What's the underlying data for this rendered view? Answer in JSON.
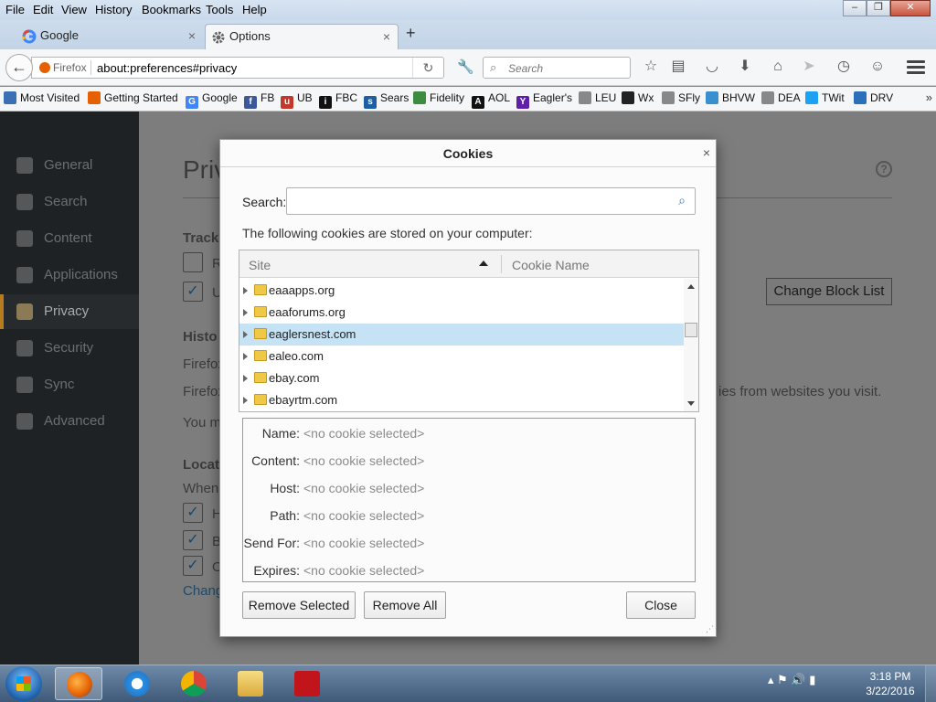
{
  "menubar": {
    "items": [
      "File",
      "Edit",
      "View",
      "History",
      "Bookmarks",
      "Tools",
      "Help"
    ],
    "accel": [
      "F",
      "E",
      "V",
      "s",
      "B",
      "T",
      "H"
    ]
  },
  "window_controls": {
    "minimize": "–",
    "maximize": "❐",
    "close": "✕"
  },
  "tabs": [
    {
      "label": "Google",
      "close": "×"
    },
    {
      "label": "Options",
      "close": "×"
    }
  ],
  "new_tab": "+",
  "navbar": {
    "identity": "Firefox",
    "url": "about:preferences#privacy",
    "search_placeholder": "Search"
  },
  "bookmarks": {
    "items": [
      {
        "label": "Most Visited",
        "color": "#3d6fb4",
        "glyph": ""
      },
      {
        "label": "Getting Started",
        "color": "#e66000",
        "glyph": ""
      },
      {
        "label": "Google",
        "color": "#4285f4",
        "glyph": "G"
      },
      {
        "label": "FB",
        "color": "#3b5998",
        "glyph": "f"
      },
      {
        "label": "UB",
        "color": "#c0392b",
        "glyph": "u"
      },
      {
        "label": "FBC",
        "color": "#111111",
        "glyph": "i"
      },
      {
        "label": "Sears",
        "color": "#1c5fa5",
        "glyph": "s"
      },
      {
        "label": "Fidelity",
        "color": "#3d8c40",
        "glyph": ""
      },
      {
        "label": "AOL",
        "color": "#111111",
        "glyph": "A"
      },
      {
        "label": "Eagler's",
        "color": "#5f1fa8",
        "glyph": "Y"
      },
      {
        "label": "LEU",
        "color": "#888888",
        "glyph": ""
      },
      {
        "label": "Wx",
        "color": "#222222",
        "glyph": ""
      },
      {
        "label": "SFly",
        "color": "#888888",
        "glyph": ""
      },
      {
        "label": "BHVW",
        "color": "#3a8fcf",
        "glyph": ""
      },
      {
        "label": "DEA",
        "color": "#888888",
        "glyph": ""
      },
      {
        "label": "TWit",
        "color": "#1da1f2",
        "glyph": ""
      },
      {
        "label": "DRV",
        "color": "#2c6fbb",
        "glyph": ""
      }
    ],
    "more": "»"
  },
  "sidebar": {
    "items": [
      {
        "label": "General"
      },
      {
        "label": "Search"
      },
      {
        "label": "Content"
      },
      {
        "label": "Applications"
      },
      {
        "label": "Privacy"
      },
      {
        "label": "Security"
      },
      {
        "label": "Sync"
      },
      {
        "label": "Advanced"
      }
    ],
    "active_index": 4
  },
  "prefs": {
    "title": "Priv",
    "tracking_heading": "Track",
    "tracking_opt1": "R",
    "tracking_opt2": "U",
    "change_block_list": "Change Block List",
    "history_heading": "Histo",
    "history_line1": "Firefox",
    "history_line2": "Firefox",
    "history_line2_tail": "ies from websites you visit.",
    "history_line3": "You m",
    "location_heading": "Locat",
    "location_when": "When",
    "location_opt1": "H",
    "location_opt2": "B",
    "location_opt3": "O",
    "location_link": "Chang",
    "help": "?"
  },
  "dialog": {
    "title": "Cookies",
    "close": "×",
    "search_label": "Search:",
    "search_value": "",
    "intro": "The following cookies are stored on your computer:",
    "columns": [
      "Site",
      "Cookie Name"
    ],
    "sites": [
      {
        "name": "eaaapps.org",
        "selected": false
      },
      {
        "name": "eaaforums.org",
        "selected": false
      },
      {
        "name": "eaglersnest.com",
        "selected": true
      },
      {
        "name": "ealeo.com",
        "selected": false
      },
      {
        "name": "ebay.com",
        "selected": false
      },
      {
        "name": "ebayrtm.com",
        "selected": false
      }
    ],
    "details": [
      {
        "label": "Name:",
        "value": "<no cookie selected>"
      },
      {
        "label": "Content:",
        "value": "<no cookie selected>"
      },
      {
        "label": "Host:",
        "value": "<no cookie selected>"
      },
      {
        "label": "Path:",
        "value": "<no cookie selected>"
      },
      {
        "label": "Send For:",
        "value": "<no cookie selected>"
      },
      {
        "label": "Expires:",
        "value": "<no cookie selected>"
      }
    ],
    "buttons": {
      "remove_selected": "Remove Selected",
      "remove_all": "Remove All",
      "close": "Close"
    }
  },
  "taskbar": {
    "time": "3:18 PM",
    "date": "3/22/2016"
  }
}
